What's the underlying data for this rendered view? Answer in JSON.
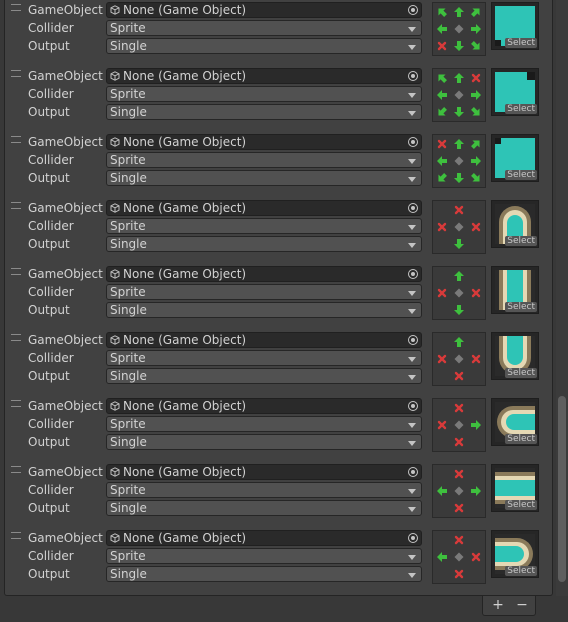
{
  "labels": {
    "game_object": "GameObject",
    "collider": "Collider",
    "output": "Output",
    "none_object": "None (Game Object)",
    "select": "Select"
  },
  "rules": [
    {
      "collider": "Sprite",
      "output": "Single",
      "neighbors": [
        "arrow",
        "arrow",
        "arrow",
        "arrow",
        "arrow",
        "no",
        "arrow",
        "arrow"
      ],
      "sprite_icon": "tile-fill-corner-bottom-left"
    },
    {
      "collider": "Sprite",
      "output": "Single",
      "neighbors": [
        "arrow",
        "arrow",
        "no",
        "arrow",
        "arrow",
        "arrow",
        "arrow",
        "arrow"
      ],
      "sprite_icon": "tile-fill-corner-top-right"
    },
    {
      "collider": "Sprite",
      "output": "Single",
      "neighbors": [
        "no",
        "arrow",
        "arrow",
        "arrow",
        "arrow",
        "arrow",
        "arrow",
        "arrow"
      ],
      "sprite_icon": "tile-fill-corner-top-left"
    },
    {
      "collider": "Sprite",
      "output": "Single",
      "neighbors": [
        "",
        "no",
        "",
        "no",
        "no",
        "",
        "arrow",
        ""
      ],
      "sprite_icon": "tile-path-end-top"
    },
    {
      "collider": "Sprite",
      "output": "Single",
      "neighbors": [
        "",
        "arrow",
        "",
        "no",
        "no",
        "",
        "arrow",
        ""
      ],
      "sprite_icon": "tile-path-vertical"
    },
    {
      "collider": "Sprite",
      "output": "Single",
      "neighbors": [
        "",
        "arrow",
        "",
        "no",
        "no",
        "",
        "no",
        ""
      ],
      "sprite_icon": "tile-path-end-bottom"
    },
    {
      "collider": "Sprite",
      "output": "Single",
      "neighbors": [
        "",
        "no",
        "",
        "no",
        "arrow",
        "",
        "no",
        ""
      ],
      "sprite_icon": "tile-path-end-left"
    },
    {
      "collider": "Sprite",
      "output": "Single",
      "neighbors": [
        "",
        "no",
        "",
        "arrow",
        "arrow",
        "",
        "no",
        ""
      ],
      "sprite_icon": "tile-path-horizontal"
    },
    {
      "collider": "Sprite",
      "output": "Single",
      "neighbors": [
        "",
        "no",
        "",
        "arrow",
        "no",
        "",
        "no",
        ""
      ],
      "sprite_icon": "tile-path-end-right"
    }
  ],
  "footer": {
    "add": "+",
    "remove": "−"
  },
  "colors": {
    "arrow": "#3ec03e",
    "no": "#d83a3a",
    "tile": "#2ec4b6",
    "tile_edge": "#e4d8b4",
    "tile_shadow": "#8a7a5a"
  }
}
